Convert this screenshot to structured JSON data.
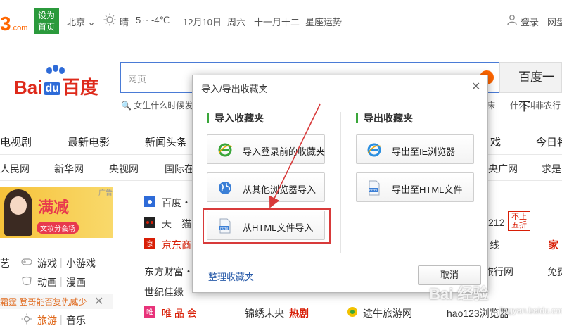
{
  "topbar": {
    "logo_fragment": "3",
    "logo_suffix": ".com",
    "home_badge_line1": "设为",
    "home_badge_line2": "首页",
    "city": "北京",
    "weather": "晴",
    "temperature": "5 ~ -4℃",
    "date": "12月10日",
    "weekday": "周六",
    "lunar": "十一月十二",
    "horoscope": "星座运势",
    "login": "登录",
    "netdisk": "网盘"
  },
  "search": {
    "brand_bai": "Bai",
    "brand_du": "du",
    "brand_cn": "百度",
    "type_label": "网页",
    "button_label": "百度一下",
    "hint_left": "女生什么时候发",
    "hint_right_fragment": "床",
    "hint_right2": "什么叫非农行"
  },
  "nav_row1": [
    "电视剧",
    "最新电影",
    "新闻头条",
    "戏",
    "今日特"
  ],
  "nav_row2": [
    "人民网",
    "新华网",
    "央视网",
    "国际在",
    "央广网",
    "求是"
  ],
  "ad": {
    "title": "满减",
    "subtitle": "文妆分会场",
    "tag": "广告"
  },
  "left_list": {
    "row1_left": "艺",
    "games": "游戏",
    "mini_games": "小游戏",
    "anime": "动画",
    "comics": "漫画",
    "notice": "霜霆 登哥能否复仇威少",
    "travel": "旅游",
    "music": "音乐"
  },
  "sites": {
    "baidu": "百度・",
    "tmall": "天　猫",
    "jd": "京东商",
    "eastmoney": "东方财富・",
    "jiayuan": "世纪佳缘",
    "vip": "唯 品 会",
    "jinxiu": "锦绣未央",
    "hot": "热剧",
    "tuniu": "途牛旅游网",
    "hao123": "hao123浏览器",
    "r212": "212",
    "line": "线",
    "travel_net": "旅行网",
    "free": "免费",
    "family": "家"
  },
  "right_badge": {
    "line1": "不止",
    "line2": "五折"
  },
  "dialog": {
    "title": "导入/导出收藏夹",
    "import_section": "导入收藏夹",
    "export_section": "导出收藏夹",
    "import_login": "导入登录前的收藏夹",
    "import_other": "从其他浏览器导入",
    "import_html": "从HTML文件导入",
    "export_ie": "导出至IE浏览器",
    "export_html": "导出至HTML文件",
    "manage": "整理收藏夹",
    "cancel": "取消"
  },
  "watermark": {
    "main": "Bai 经验",
    "sub": "jingyan.baidu.com"
  },
  "colors": {
    "baidu_red": "#de2a1b",
    "baidu_blue": "#2e6bd8",
    "search_border": "#4a7bd6",
    "green_accent": "#3aa63a",
    "highlight_red": "#d83a3a"
  }
}
